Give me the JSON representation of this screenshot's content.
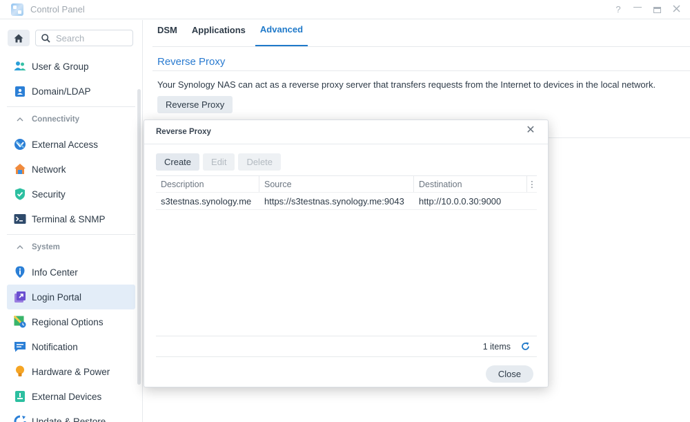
{
  "window": {
    "title": "Control Panel",
    "help": "?"
  },
  "sidebar": {
    "search_placeholder": "Search",
    "items_top": [
      {
        "label": "User & Group"
      },
      {
        "label": "Domain/LDAP"
      }
    ],
    "sections": [
      {
        "label": "Connectivity",
        "items": [
          {
            "label": "External Access"
          },
          {
            "label": "Network"
          },
          {
            "label": "Security"
          },
          {
            "label": "Terminal & SNMP"
          }
        ]
      },
      {
        "label": "System",
        "items": [
          {
            "label": "Info Center"
          },
          {
            "label": "Login Portal"
          },
          {
            "label": "Regional Options"
          },
          {
            "label": "Notification"
          },
          {
            "label": "Hardware & Power"
          },
          {
            "label": "External Devices"
          },
          {
            "label": "Update & Restore"
          }
        ]
      }
    ],
    "active_item": "Login Portal"
  },
  "main": {
    "tabs": [
      {
        "label": "DSM"
      },
      {
        "label": "Applications"
      },
      {
        "label": "Advanced"
      }
    ],
    "active_tab": "Advanced",
    "section_title": "Reverse Proxy",
    "description": "Your Synology NAS can act as a reverse proxy server that transfers requests from the Internet to devices in the local network.",
    "button_label": "Reverse Proxy"
  },
  "dialog": {
    "title": "Reverse Proxy",
    "close_glyph": "✕",
    "toolbar": {
      "create": "Create",
      "edit": "Edit",
      "delete": "Delete"
    },
    "columns": [
      "Description",
      "Source",
      "Destination"
    ],
    "column_menu_glyph": "⋮",
    "rows": [
      {
        "description": "s3testnas.synology.me",
        "source": "https://s3testnas.synology.me:9043",
        "destination": "http://10.0.0.30:9000"
      }
    ],
    "item_count": "1 items",
    "close_button": "Close"
  },
  "colors": {
    "accent": "#1f79c9",
    "active_bg": "#e3edf8",
    "button_bg": "#e6ebf0"
  }
}
